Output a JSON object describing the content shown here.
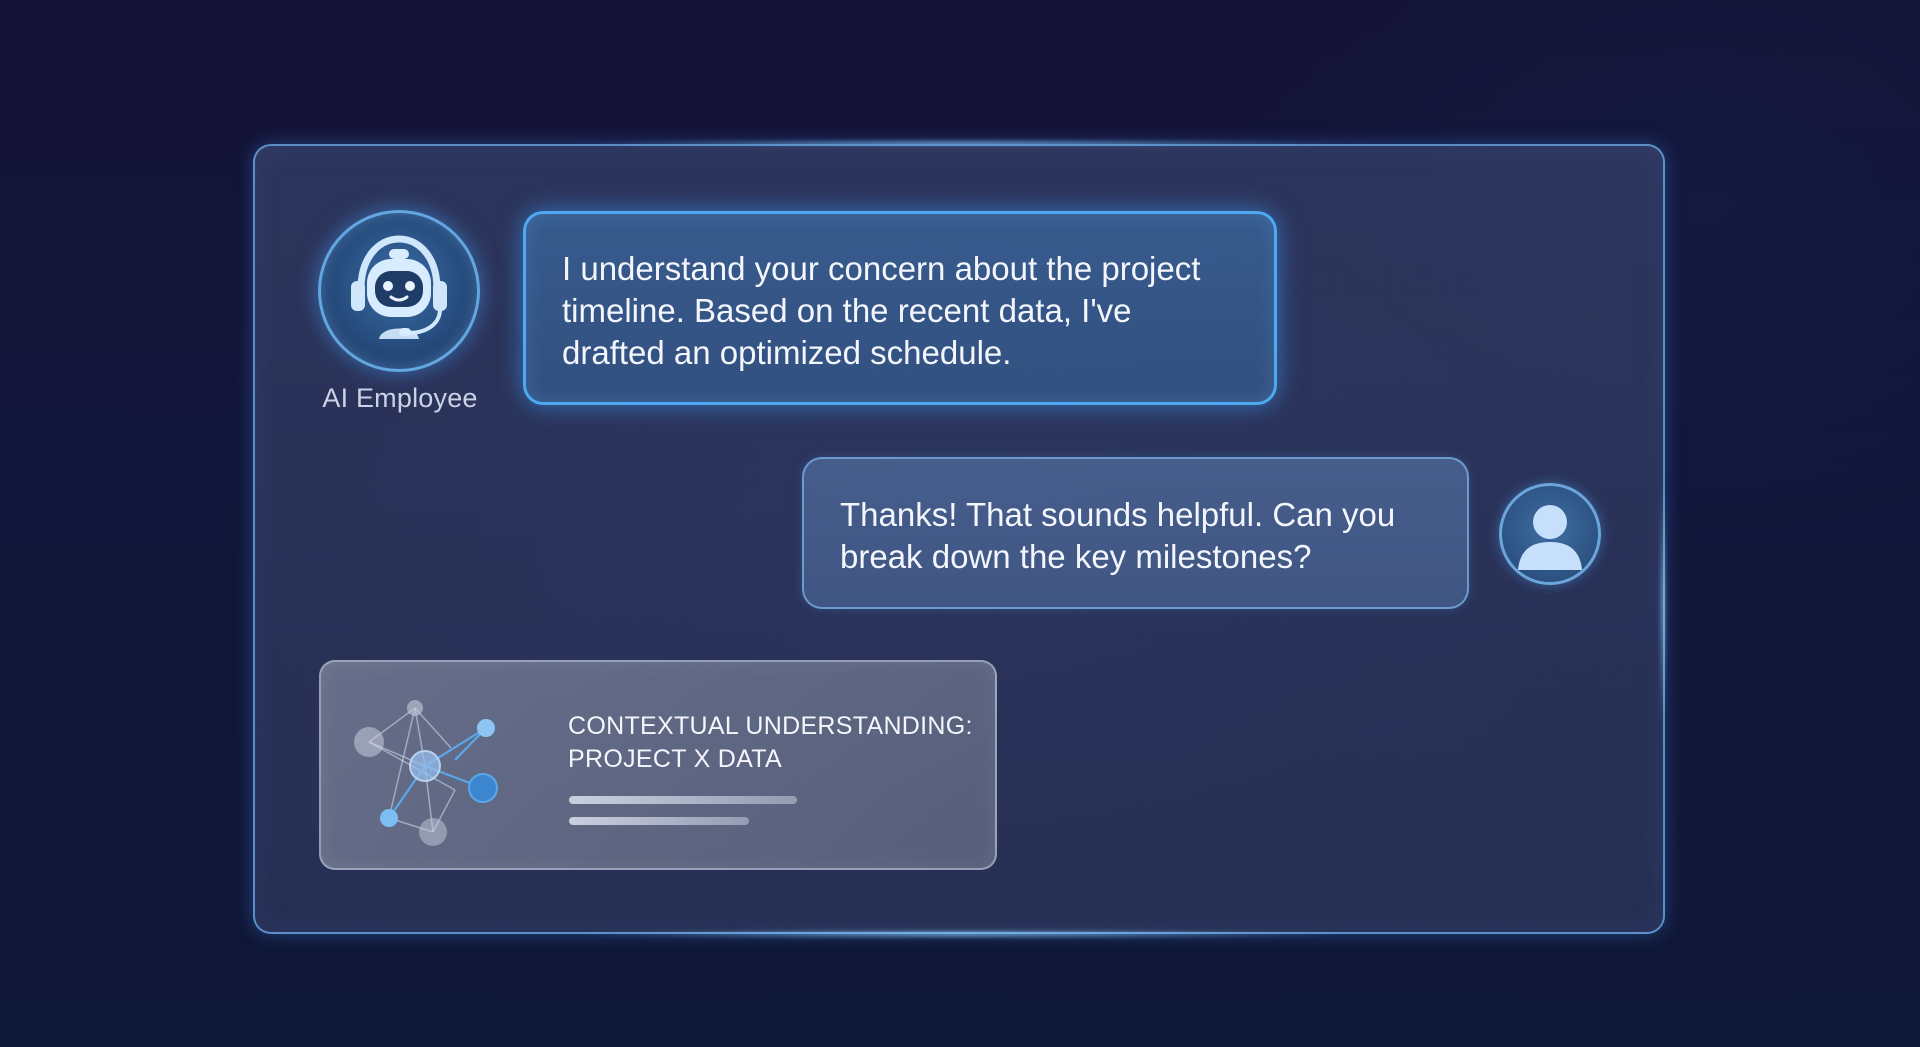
{
  "assistant": {
    "name": "AI Employee",
    "avatar_icon": "robot-headset-icon",
    "message": "I understand your concern about the project timeline. Based on the recent data, I've drafted an optimized schedule."
  },
  "user": {
    "avatar_icon": "user-icon",
    "message": "Thanks! That sounds helpful. Can you break down the key milestones?"
  },
  "context_card": {
    "icon": "network-graph-icon",
    "title": "CONTEXTUAL UNDERSTANDING: PROJECT X DATA"
  },
  "colors": {
    "accent_glow": "#50aff5",
    "background": "#141236",
    "panel": "#343e66"
  }
}
